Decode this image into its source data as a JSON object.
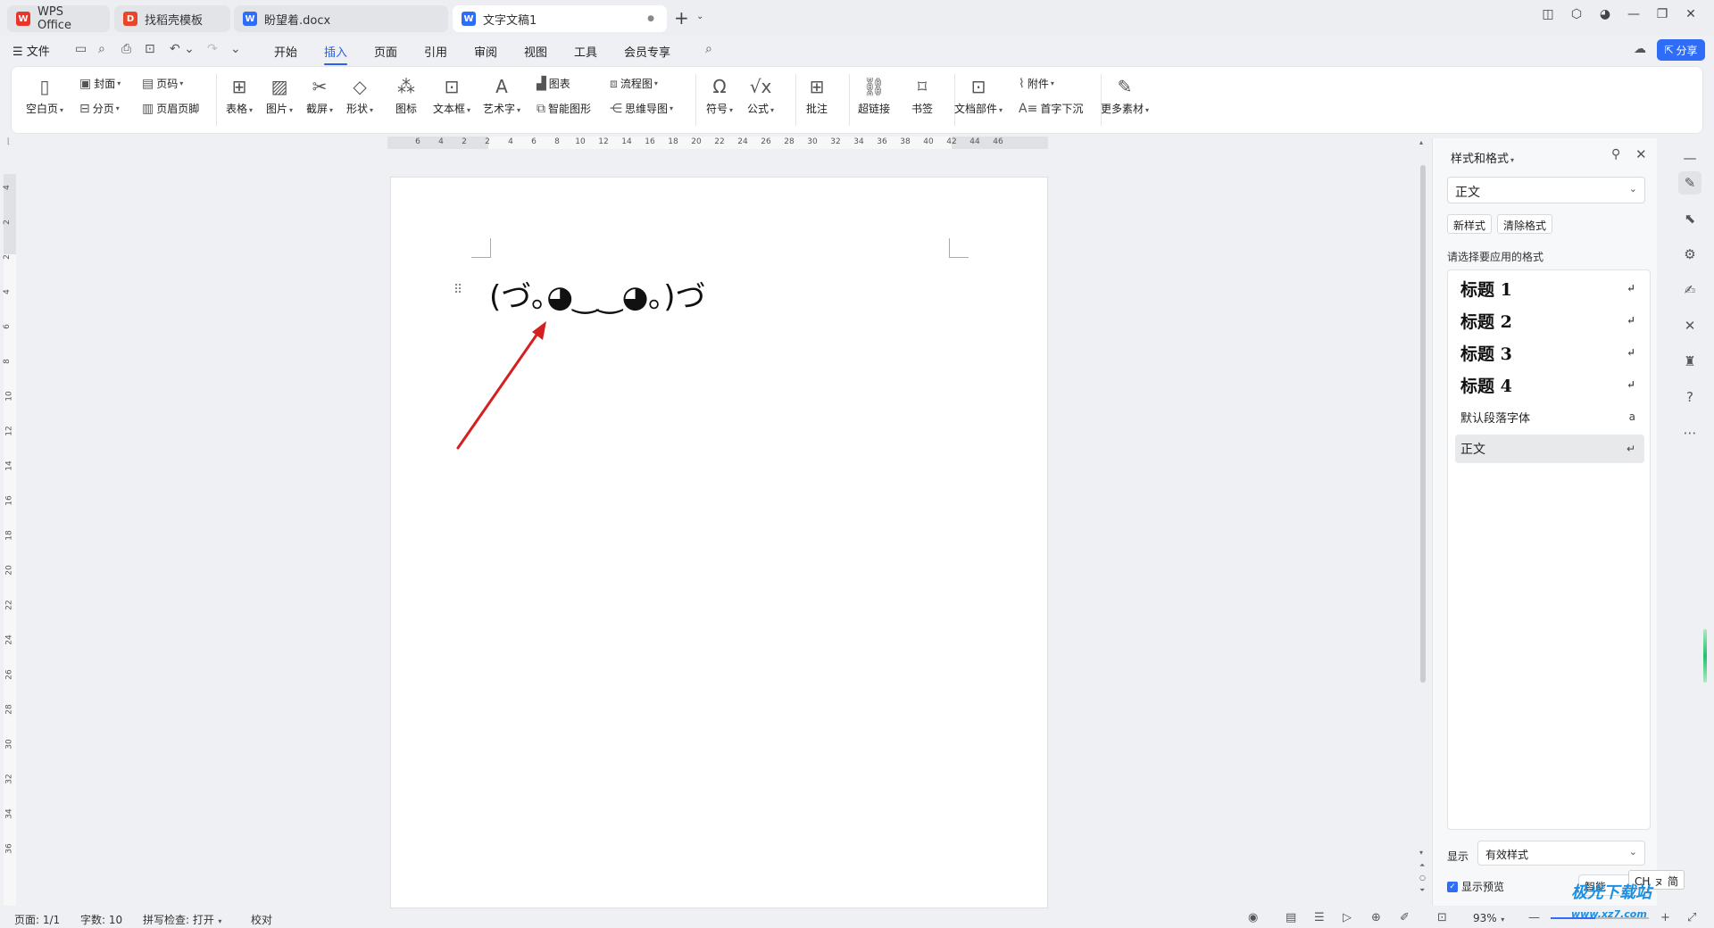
{
  "tabs": [
    {
      "label": "WPS Office",
      "icon": "wps-logo"
    },
    {
      "label": "找稻壳模板",
      "icon": "docer-logo"
    },
    {
      "label": "盼望着.docx",
      "icon": "word-doc"
    },
    {
      "label": "文字文稿1",
      "icon": "word-doc",
      "active": true
    }
  ],
  "menu": {
    "file": "☰ 文件",
    "tabs": [
      "开始",
      "插入",
      "页面",
      "引用",
      "审阅",
      "视图",
      "工具",
      "会员专享"
    ],
    "active_tab": "插入",
    "share": "分享"
  },
  "ribbon": {
    "blank_page": "空白页",
    "cover": "封面",
    "page_break": "分页",
    "page_number": "页码",
    "header_footer": "页眉页脚",
    "table": "表格",
    "picture": "图片",
    "screenshot": "截屏",
    "shape": "形状",
    "icon": "图标",
    "textbox": "文本框",
    "wordart": "艺术字",
    "chart": "图表",
    "smart_graphic": "智能图形",
    "flowchart": "流程图",
    "mindmap": "思维导图",
    "symbol": "符号",
    "formula": "公式",
    "comment": "批注",
    "hyperlink": "超链接",
    "bookmark": "书签",
    "doc_parts": "文档部件",
    "attachment": "附件",
    "drop_cap": "首字下沉",
    "more": "更多素材"
  },
  "ruler": {
    "h_ticks": [
      "6",
      "4",
      "2",
      "2",
      "4",
      "6",
      "8",
      "10",
      "12",
      "14",
      "16",
      "18",
      "20",
      "22",
      "24",
      "26",
      "28",
      "30",
      "32",
      "34",
      "36",
      "38",
      "40",
      "42",
      "44",
      "46"
    ],
    "v_ticks": [
      "4",
      "2",
      "2",
      "4",
      "6",
      "8",
      "10",
      "12",
      "14",
      "16",
      "18",
      "20",
      "22",
      "24",
      "26",
      "28",
      "30",
      "32",
      "34",
      "36"
    ]
  },
  "document": {
    "text": "(づ｡◕‿‿◕｡)づ"
  },
  "panel": {
    "title": "样式和格式",
    "current_style": "正文",
    "new_style": "新样式",
    "clear_format": "清除格式",
    "choose_label": "请选择要应用的格式",
    "styles": [
      {
        "name": "标题  1",
        "heading": true
      },
      {
        "name": "标题  2",
        "heading": true
      },
      {
        "name": "标题  3",
        "heading": true
      },
      {
        "name": "标题  4",
        "heading": true
      },
      {
        "name": "默认段落字体",
        "heading": false
      },
      {
        "name": "正文",
        "heading": false,
        "selected": true
      }
    ],
    "show_label": "显示",
    "show_value": "有效样式",
    "preview_label": "显示预览",
    "smart_label": "智能"
  },
  "ime": "CH ㇴ 简",
  "status": {
    "page": "页面: 1/1",
    "words": "字数: 10",
    "spell": "拼写检查: 打开",
    "proof": "校对",
    "zoom": "93%"
  },
  "watermark": "极光下载站",
  "watermark_url": "www.xz7.com",
  "colors": {
    "accent": "#2b62e3",
    "share": "#2f6df6",
    "arrow": "#d42020"
  }
}
